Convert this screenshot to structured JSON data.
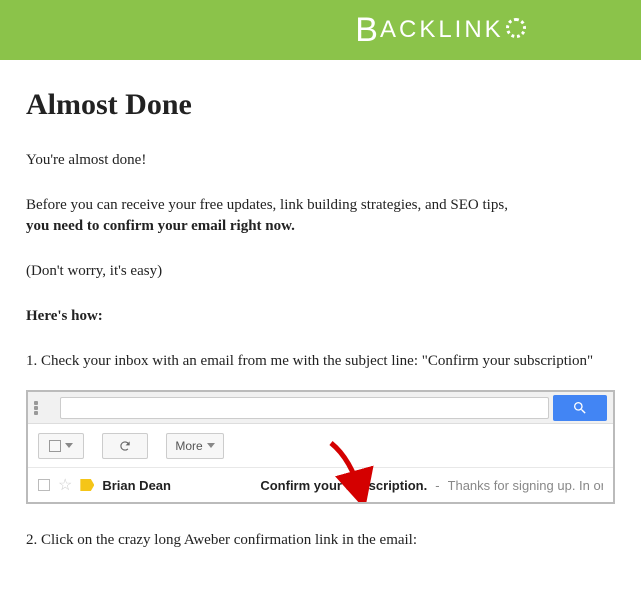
{
  "brand": {
    "big_b": "B",
    "rest": "ACKLINK"
  },
  "title": "Almost Done",
  "p1": "You're almost done!",
  "p2a": "Before you can receive your free updates, link building strategies, and SEO tips,",
  "p2b": "you need to confirm your email right now.",
  "p3": "(Don't worry, it's easy)",
  "p4": "Here's how:",
  "step1": "1. Check your inbox with an email from me with the subject line: \"Confirm your subscription\"",
  "step2": "2. Click on the crazy long Aweber confirmation link in the email:",
  "gmail": {
    "more_label": "More",
    "row": {
      "sender": "Brian Dean",
      "subject": "Confirm your subscription.",
      "separator": " - ",
      "snippet": "Thanks for signing up. In order to r"
    }
  }
}
